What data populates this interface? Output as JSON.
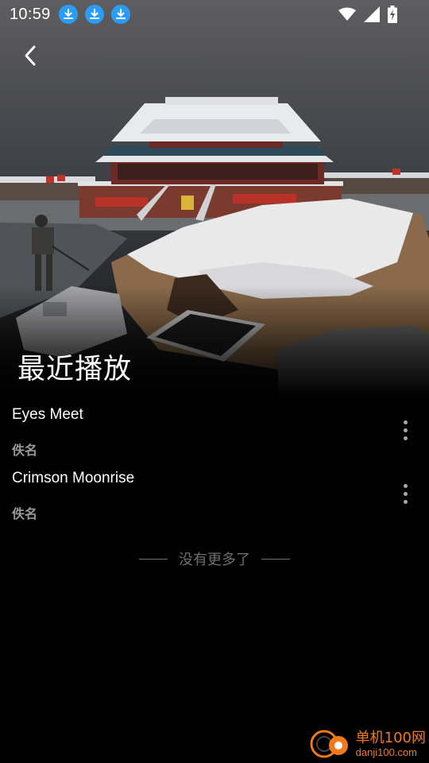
{
  "status_bar": {
    "time": "10:59",
    "notification_icons": [
      "download-icon",
      "download-icon",
      "download-icon"
    ],
    "right_icons": [
      "wifi-icon",
      "signal-icon",
      "battery-charging-icon"
    ]
  },
  "header": {
    "back_icon": "chevron-left-icon",
    "title": "最近播放"
  },
  "songs": [
    {
      "title": "Eyes Meet",
      "artist": "佚名"
    },
    {
      "title": "Crimson Moonrise",
      "artist": "佚名"
    }
  ],
  "footer_note": "没有更多了",
  "watermark": {
    "cn": "单机100网",
    "en": "danji100.com"
  },
  "colors": {
    "background": "#000000",
    "download_badge": "#2a9df4",
    "secondary_text": "#9a9a9a",
    "watermark": "#f07a1a"
  }
}
